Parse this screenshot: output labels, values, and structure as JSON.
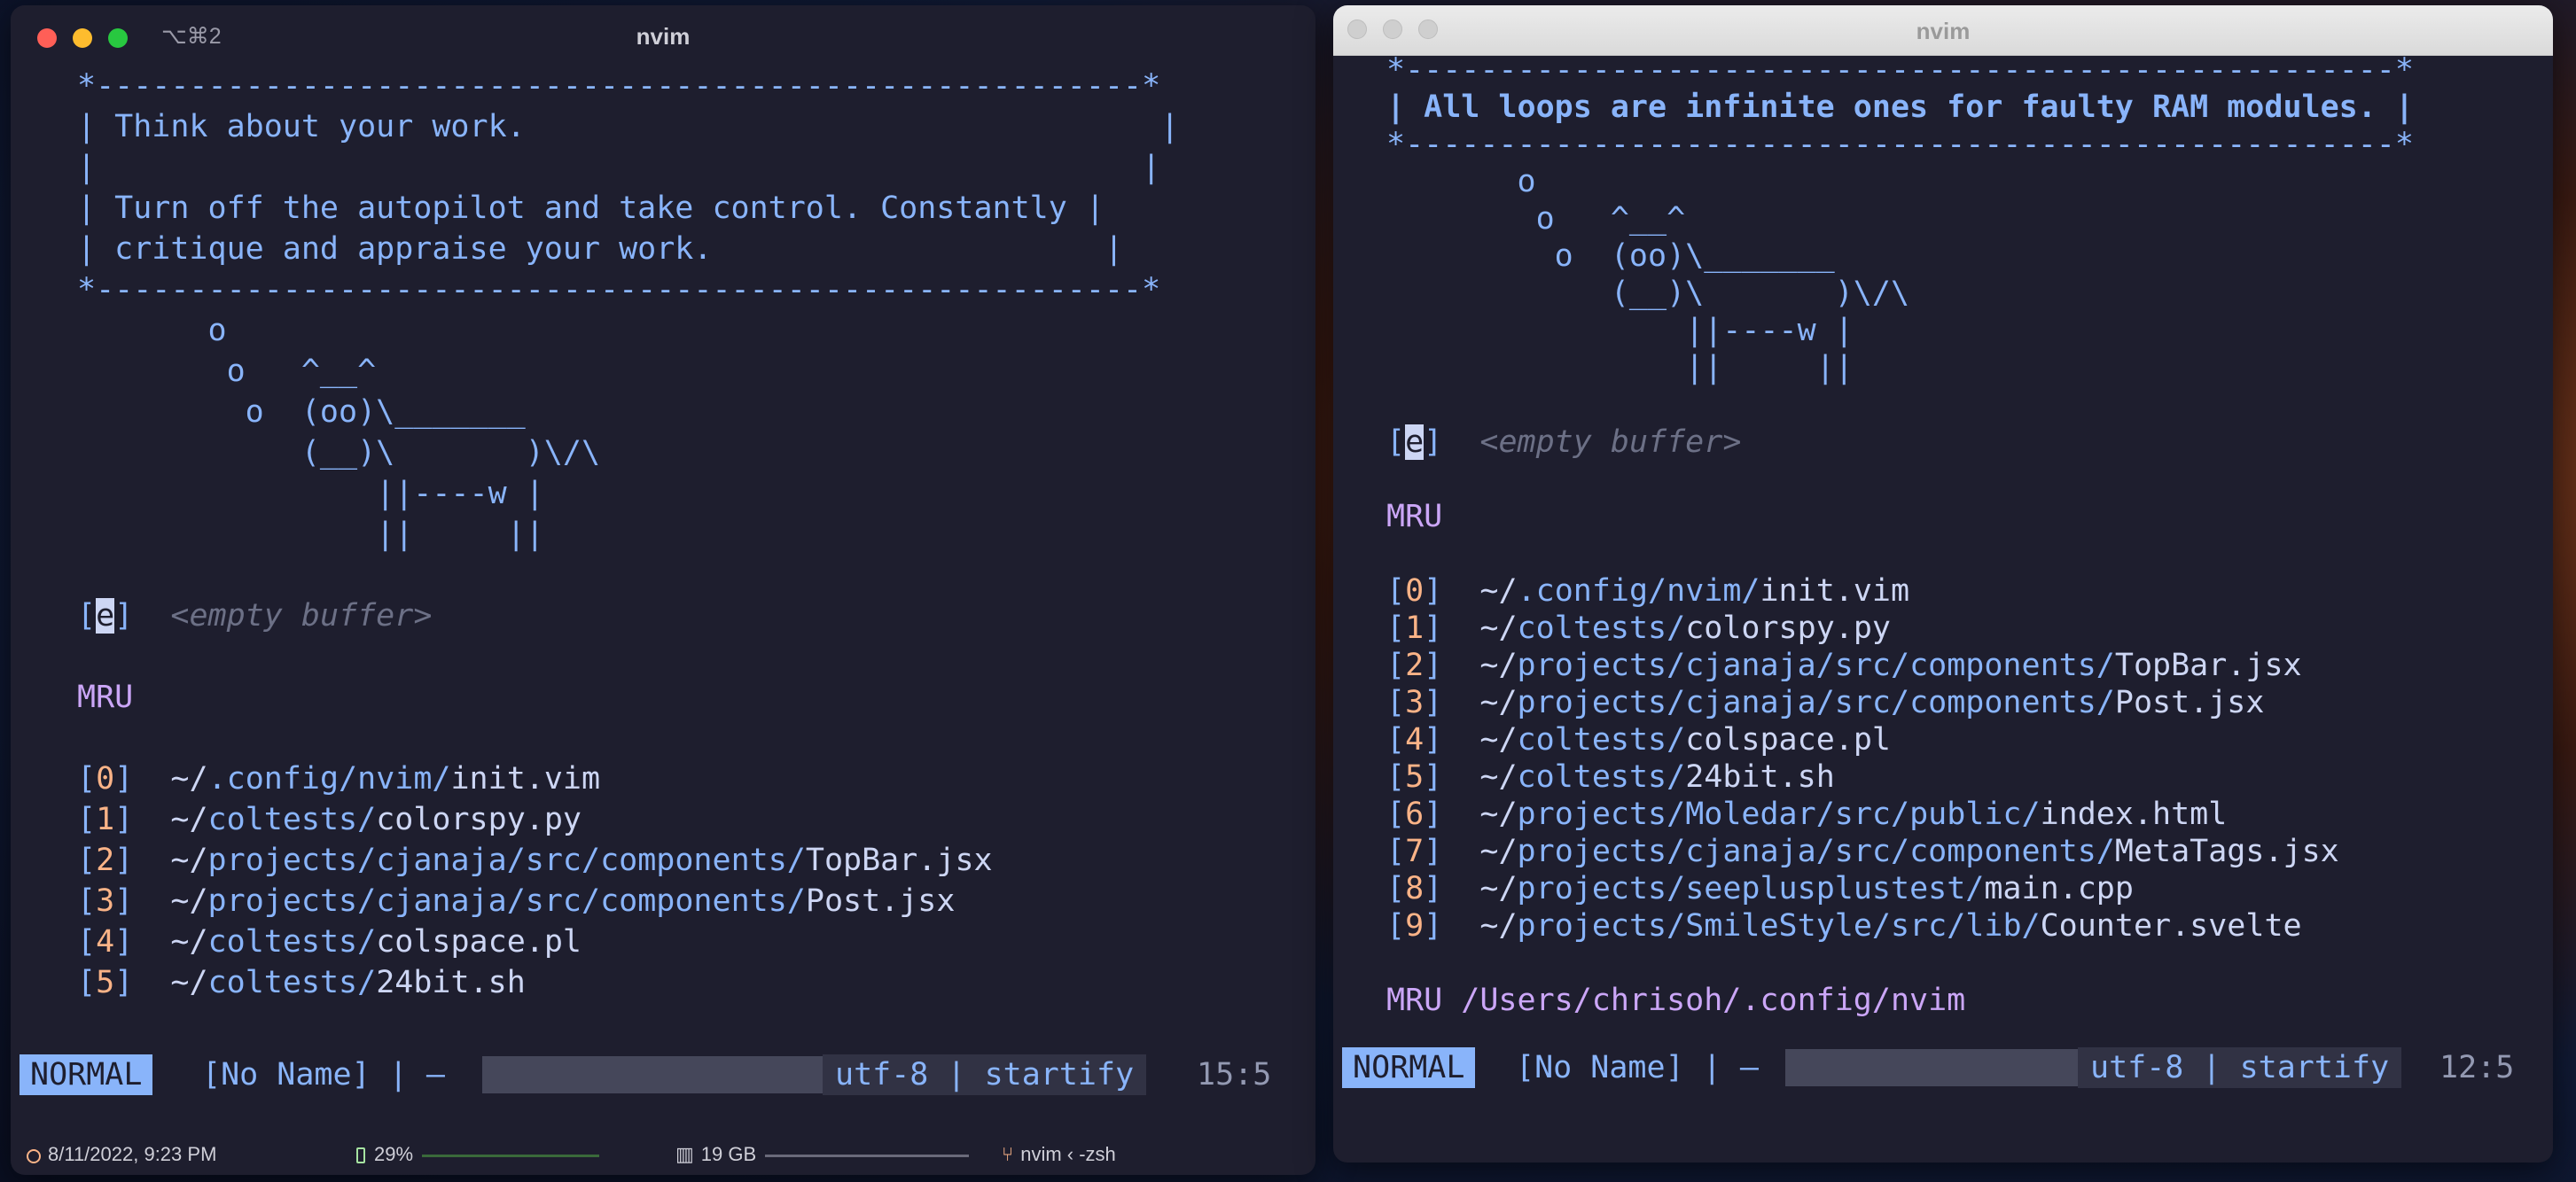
{
  "left_window": {
    "shortcut": "⌥⌘2",
    "title": "nvim",
    "lines": [
      {
        "cls": "box",
        "text": "*--------------------------------------------------------*"
      },
      {
        "cls": "box",
        "text": "| Think about your work.                                  |"
      },
      {
        "cls": "box",
        "text": "|                                                        |"
      },
      {
        "cls": "box",
        "text": "| Turn off the autopilot and take control. Constantly |"
      },
      {
        "cls": "box",
        "text": "| critique and appraise your work.                     |"
      },
      {
        "cls": "box",
        "text": "*--------------------------------------------------------*"
      },
      {
        "cls": "cow",
        "text": "       o"
      },
      {
        "cls": "cow",
        "text": "        o   ^__^"
      },
      {
        "cls": "cow",
        "text": "         o  (oo)\\_______"
      },
      {
        "cls": "cow",
        "text": "            (__)\\       )\\/\\"
      },
      {
        "cls": "cow",
        "text": "                ||----w |"
      },
      {
        "cls": "cow",
        "text": "                ||     ||"
      }
    ],
    "empty_buffer": {
      "key": "e",
      "label": "<empty buffer>"
    },
    "mru_header": "MRU",
    "mru": [
      {
        "n": "0",
        "dirs": [
          "~/",
          ".config/",
          "nvim/"
        ],
        "file": "init.vim"
      },
      {
        "n": "1",
        "dirs": [
          "~/",
          "coltests/"
        ],
        "file": "colorspy.py"
      },
      {
        "n": "2",
        "dirs": [
          "~/",
          "projects/",
          "cjanaja/",
          "src/",
          "components/"
        ],
        "file": "TopBar.jsx"
      },
      {
        "n": "3",
        "dirs": [
          "~/",
          "projects/",
          "cjanaja/",
          "src/",
          "components/"
        ],
        "file": "Post.jsx"
      },
      {
        "n": "4",
        "dirs": [
          "~/",
          "coltests/"
        ],
        "file": "colspace.pl"
      },
      {
        "n": "5",
        "dirs": [
          "~/",
          "coltests/"
        ],
        "file": "24bit.sh"
      }
    ],
    "status": {
      "mode": "NORMAL",
      "file": "[No Name] | –",
      "encoding": "utf-8 | startify",
      "position": "15:5"
    }
  },
  "right_window": {
    "title": "nvim",
    "lines": [
      {
        "cls": "box",
        "text": "*-----------------------------------------------------*"
      },
      {
        "cls": "box-bold",
        "text": "| All loops are infinite ones for faulty RAM modules. |"
      },
      {
        "cls": "box",
        "text": "*-----------------------------------------------------*"
      },
      {
        "cls": "cow",
        "text": "       o"
      },
      {
        "cls": "cow",
        "text": "        o   ^__^"
      },
      {
        "cls": "cow",
        "text": "         o  (oo)\\_______"
      },
      {
        "cls": "cow",
        "text": "            (__)\\       )\\/\\"
      },
      {
        "cls": "cow",
        "text": "                ||----w |"
      },
      {
        "cls": "cow",
        "text": "                ||     ||"
      }
    ],
    "empty_buffer": {
      "key": "e",
      "label": "<empty buffer>"
    },
    "mru_header": "MRU",
    "mru": [
      {
        "n": "0",
        "dirs": [
          "~/",
          ".config/",
          "nvim/"
        ],
        "file": "init.vim"
      },
      {
        "n": "1",
        "dirs": [
          "~/",
          "coltests/"
        ],
        "file": "colorspy.py"
      },
      {
        "n": "2",
        "dirs": [
          "~/",
          "projects/",
          "cjanaja/",
          "src/",
          "components/"
        ],
        "file": "TopBar.jsx"
      },
      {
        "n": "3",
        "dirs": [
          "~/",
          "projects/",
          "cjanaja/",
          "src/",
          "components/"
        ],
        "file": "Post.jsx"
      },
      {
        "n": "4",
        "dirs": [
          "~/",
          "coltests/"
        ],
        "file": "colspace.pl"
      },
      {
        "n": "5",
        "dirs": [
          "~/",
          "coltests/"
        ],
        "file": "24bit.sh"
      },
      {
        "n": "6",
        "dirs": [
          "~/",
          "projects/",
          "Moledar/",
          "src/",
          "public/"
        ],
        "file": "index.html"
      },
      {
        "n": "7",
        "dirs": [
          "~/",
          "projects/",
          "cjanaja/",
          "src/",
          "components/"
        ],
        "file": "MetaTags.jsx"
      },
      {
        "n": "8",
        "dirs": [
          "~/",
          "projects/",
          "seeplusplustest/"
        ],
        "file": "main.cpp"
      },
      {
        "n": "9",
        "dirs": [
          "~/",
          "projects/",
          "SmileStyle/",
          "src/",
          "lib/"
        ],
        "file": "Counter.svelte"
      }
    ],
    "mru_footer": "MRU /Users/chrisoh/.config/nvim",
    "status": {
      "mode": "NORMAL",
      "file": "[No Name] | –",
      "encoding": "utf-8 | startify",
      "position": "12:5"
    }
  },
  "menubar": {
    "datetime": "8/11/2022, 9:23 PM",
    "battery": "29%",
    "disk": "19 GB",
    "process": "nvim ‹ -zsh"
  },
  "colors": {
    "accent": "#89b4fa",
    "number": "#fab387",
    "mru": "#cba6f7",
    "bg": "#1e1e2e"
  }
}
